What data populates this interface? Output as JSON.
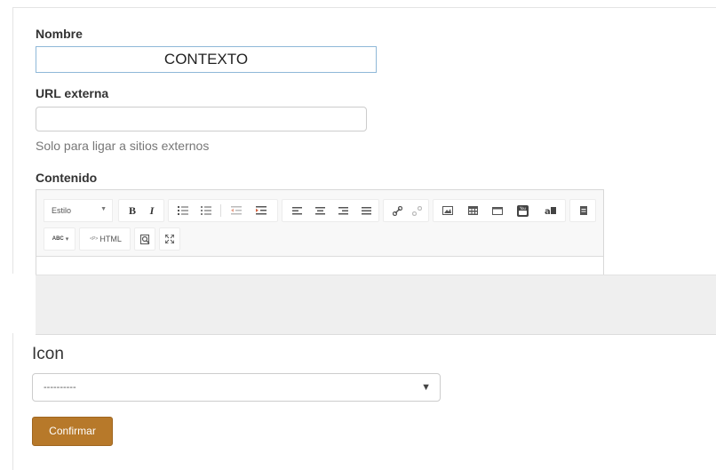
{
  "form": {
    "name_label": "Nombre",
    "name_value": "CONTEXTO",
    "url_label": "URL externa",
    "url_value": "",
    "url_help": "Solo para ligar a sitios externos",
    "content_label": "Contenido",
    "editor": {
      "style_combo": "Estilo",
      "toolbar_row1": [
        {
          "name": "bold-button",
          "glyph": "B"
        },
        {
          "name": "italic-button",
          "glyph": "I"
        },
        {
          "name": "numbered-list-button",
          "glyph": "1≡"
        },
        {
          "name": "bulleted-list-button",
          "glyph": "•≡"
        },
        {
          "name": "outdent-button",
          "glyph": "⇤"
        },
        {
          "name": "indent-button",
          "glyph": "⇥"
        },
        {
          "name": "align-left-button",
          "glyph": "≡"
        },
        {
          "name": "align-center-button",
          "glyph": "≡"
        },
        {
          "name": "align-right-button",
          "glyph": "≡"
        },
        {
          "name": "justify-button",
          "glyph": "≡"
        },
        {
          "name": "link-button",
          "glyph": "🔗"
        },
        {
          "name": "unlink-button",
          "glyph": "⛓"
        },
        {
          "name": "image-button",
          "glyph": "▣"
        },
        {
          "name": "table-button",
          "glyph": "▦"
        },
        {
          "name": "iframe-button",
          "glyph": "▭"
        },
        {
          "name": "youtube-button",
          "glyph": "▶"
        },
        {
          "name": "special-char-button",
          "glyph": "a¢"
        },
        {
          "name": "source-doc-button",
          "glyph": "▤"
        }
      ],
      "spellcheck_label": "ABC",
      "html_label": "HTML",
      "html_prefix": "<P>"
    },
    "icon_label": "Icon",
    "icon_select_value": "----------",
    "submit_label": "Confirmar"
  }
}
